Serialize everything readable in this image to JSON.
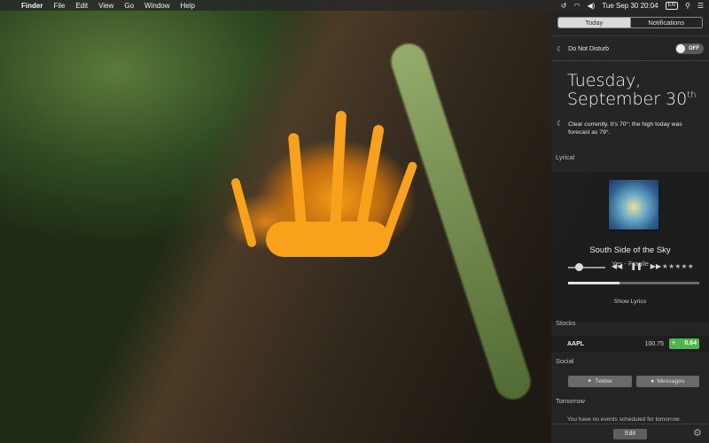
{
  "menubar": {
    "apple": "",
    "app": "Finder",
    "items": [
      "File",
      "Edit",
      "View",
      "Go",
      "Window",
      "Help"
    ],
    "datetime": "Tue Sep 30  20:04",
    "battery": "EN",
    "icons": [
      "time-machine-icon",
      "wifi-icon",
      "volume-icon",
      "search-icon",
      "list-icon"
    ]
  },
  "notification_center": {
    "tabs": [
      "Today",
      "Notifications"
    ],
    "active_tab": "Today",
    "dnd": {
      "label": "Do Not Disturb",
      "toggle": "OFF"
    },
    "date": {
      "day": "Tuesday,",
      "month": "September 30",
      "suffix": "th"
    },
    "weather": "Clear currently. It's 70°; the high today was forecast as 79°.",
    "lyrical": {
      "section": "Lyrical",
      "song": "South Side of the Sky",
      "artist": "Yes - Fragile",
      "controls": [
        "◀◀",
        "❚❚",
        "▶▶"
      ],
      "stars": "★★★★★",
      "volume_fraction": 0.3,
      "progress_fraction": 0.39,
      "show_lyrics": "Show Lyrics"
    },
    "stocks": {
      "section": "Stocks",
      "symbol": "AAPL",
      "price": "100.75",
      "change_sign": "+",
      "change": "0.64"
    },
    "social": {
      "section": "Social",
      "twitter": "Twitter",
      "messages": "Messages"
    },
    "tomorrow": {
      "section": "Tomorrow",
      "text": "You have no events scheduled for tomorrow."
    },
    "edit": "Edit"
  },
  "colors": {
    "stock_up": "#4cb84c",
    "panel": "#262626"
  }
}
